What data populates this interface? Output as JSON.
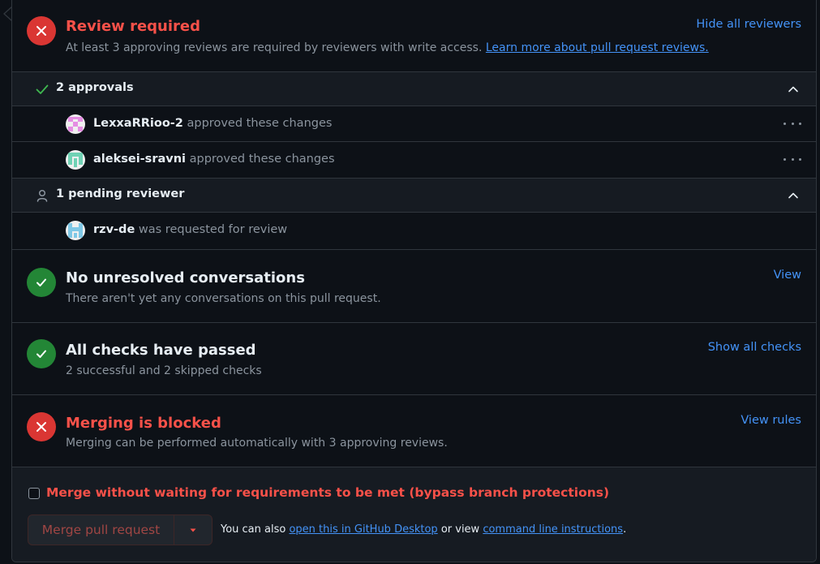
{
  "review": {
    "title": "Review required",
    "subtitle": "At least 3 approving reviews are required by reviewers with write access. ",
    "learn_link": "Learn more about pull request reviews.",
    "hide_link": "Hide all reviewers"
  },
  "approvals": {
    "title": "2 approvals",
    "reviewers": [
      {
        "name": "LexxaRRioo-2",
        "action": " approved these changes",
        "avatar_color": "#e58ee3"
      },
      {
        "name": "aleksei-sravni",
        "action": " approved these changes",
        "avatar_color": "#6fd2b4"
      }
    ]
  },
  "pending": {
    "title": "1 pending reviewer",
    "reviewers": [
      {
        "name": "rzv-de",
        "action": " was requested for review",
        "avatar_color": "#7fc8e6"
      }
    ]
  },
  "conversations": {
    "title": "No unresolved conversations",
    "subtitle": "There aren't yet any conversations on this pull request.",
    "link": "View"
  },
  "checks": {
    "title": "All checks have passed",
    "subtitle": "2 successful and 2 skipped checks",
    "link": "Show all checks"
  },
  "merging": {
    "title": "Merging is blocked",
    "subtitle": "Merging can be performed automatically with 3 approving reviews.",
    "link": "View rules"
  },
  "merge": {
    "bypass_label": "Merge without waiting for requirements to be met (bypass branch protections)",
    "button_label": "Merge pull request",
    "alt_prefix": "You can also ",
    "desktop_link": "open this in GitHub Desktop",
    "alt_middle": " or view ",
    "cli_link": "command line instructions",
    "alt_suffix": "."
  },
  "colors": {
    "danger": "#f85149",
    "success": "#238636",
    "accent": "#4493f8",
    "muted": "#8b949e"
  }
}
